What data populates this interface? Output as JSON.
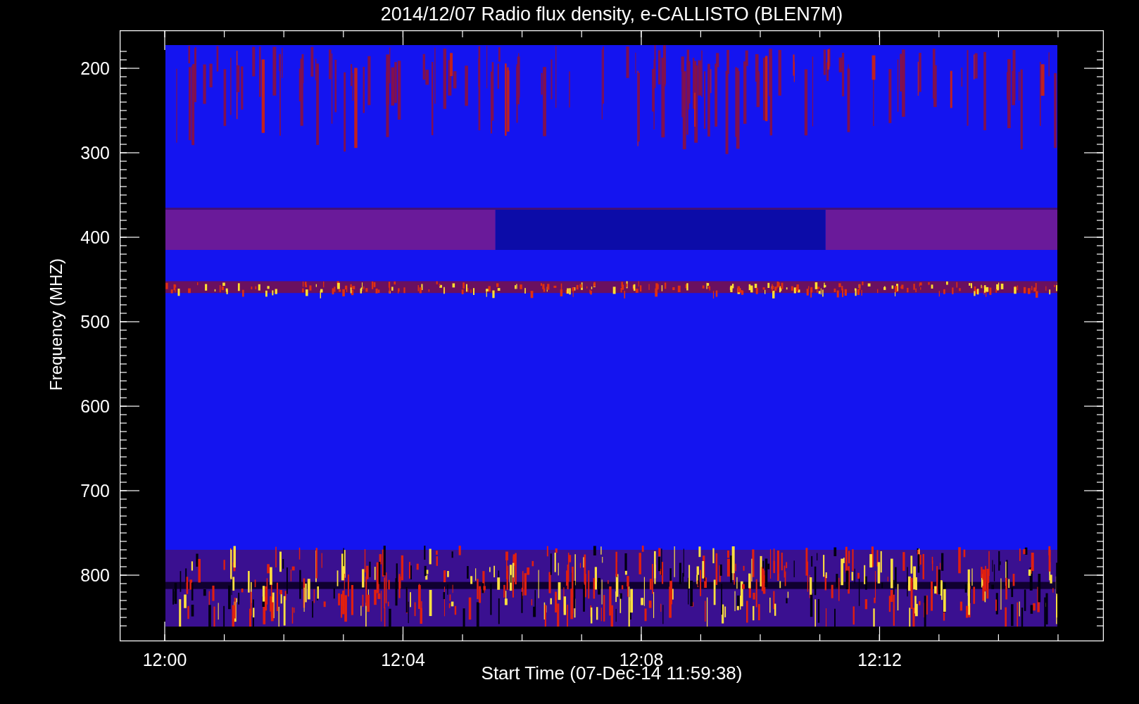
{
  "title": "2014/12/07  Radio flux density, e-CALLISTO (BLEN7M)",
  "y_axis": {
    "label": "Frequency (MHZ)",
    "ticks": [
      "200",
      "300",
      "400",
      "500",
      "600",
      "700",
      "800"
    ]
  },
  "x_axis": {
    "label": "Start Time (07-Dec-14 11:59:38)",
    "ticks": [
      "12:00",
      "12:04",
      "12:08",
      "12:12"
    ]
  }
}
